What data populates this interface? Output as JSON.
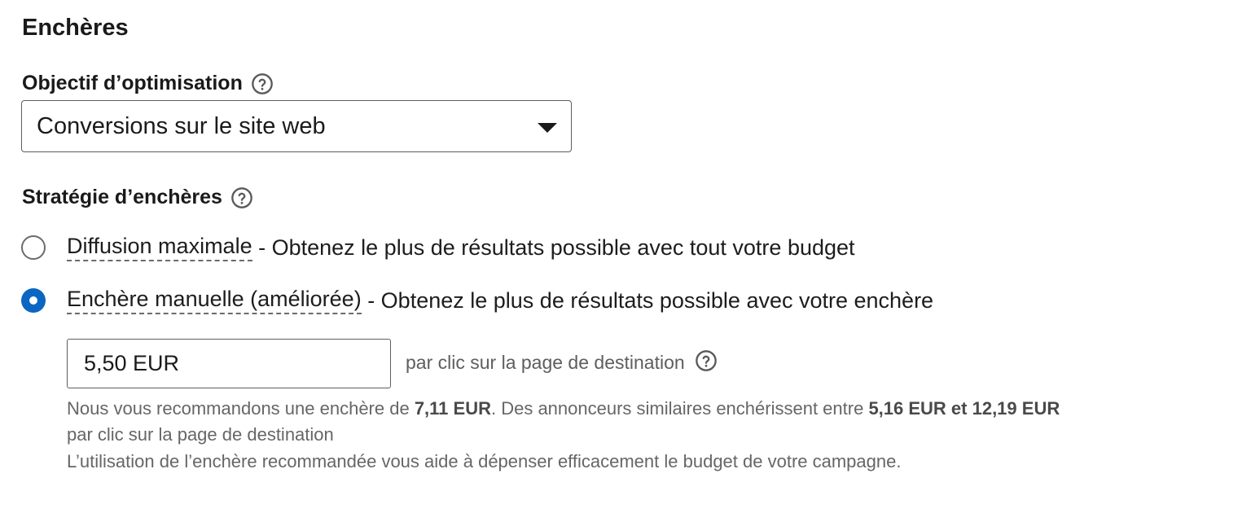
{
  "section": {
    "title": "Enchères"
  },
  "optimization": {
    "label": "Objectif d’optimisation",
    "selected_value": "Conversions sur le site web"
  },
  "strategy": {
    "label": "Stratégie d’enchères",
    "options": [
      {
        "name": "Diffusion maximale",
        "description": " - Obtenez le plus de résultats possible avec tout votre budget",
        "selected": false
      },
      {
        "name": "Enchère manuelle (améliorée)",
        "description": " - Obtenez le plus de résultats possible avec votre enchère",
        "selected": true
      }
    ]
  },
  "bid": {
    "value": "5,50 EUR",
    "unit_label": "par clic sur la page de destination",
    "recommendation": {
      "prefix": "Nous vous recommandons une enchère de ",
      "recommended": "7,11 EUR",
      "middle": ". Des annonceurs similaires enchérissent entre ",
      "range": "5,16 EUR et 12,19 EUR",
      "line2": "par clic sur la page de destination",
      "line3": "L’utilisation de l’enchère recommandée vous aide à dépenser efficacement le budget de votre campagne."
    }
  },
  "colors": {
    "accent": "#0a66c2",
    "text": "#1a1a1a",
    "muted": "#666666"
  },
  "icons": {
    "help": "question-circle-icon",
    "dropdown": "caret-down-icon"
  }
}
